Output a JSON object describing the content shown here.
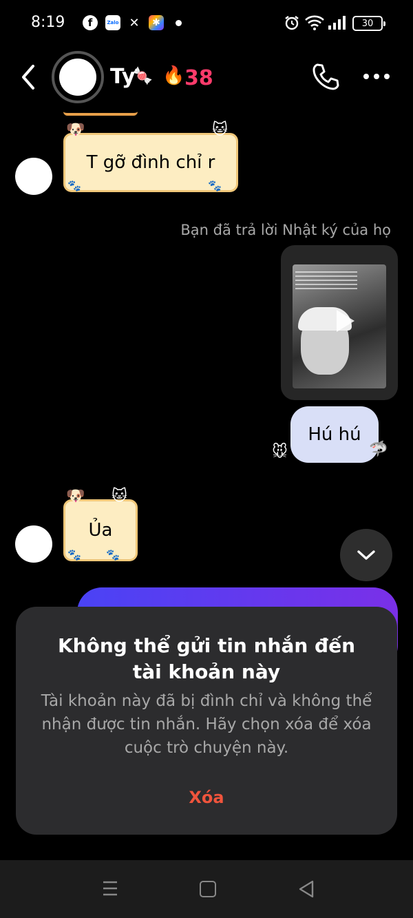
{
  "status_bar": {
    "time": "8:19",
    "battery": "30",
    "apps": [
      "facebook-icon",
      "zalo-icon",
      "capcut-icon",
      "photos-icon"
    ],
    "zalo_label": "Zalo"
  },
  "header": {
    "name": "Ty",
    "emoji": "🍬",
    "streak_emoji": "🔥",
    "streak_count": "38"
  },
  "messages": {
    "note_1": "T gỡ đình chỉ r",
    "reply_caption": "Bạn đã trả lời Nhật ký của họ",
    "sent_text": "Hú hú",
    "note_2": "Ủa"
  },
  "dialog": {
    "title": "Không thể gửi tin nhắn đến tài khoản này",
    "message": "Tài khoản này đã bị đình chỉ và không thể nhận được tin nhắn. Hãy chọn xóa để xóa cuộc trò chuyện này.",
    "delete_label": "Xóa"
  },
  "colors": {
    "background": "#000000",
    "dialog_bg": "#2c2c2e",
    "delete": "#f0543c",
    "streak": "#ff3b6b",
    "sent_bubble": "#d9dff7",
    "note_bg": "#fdedc2"
  }
}
